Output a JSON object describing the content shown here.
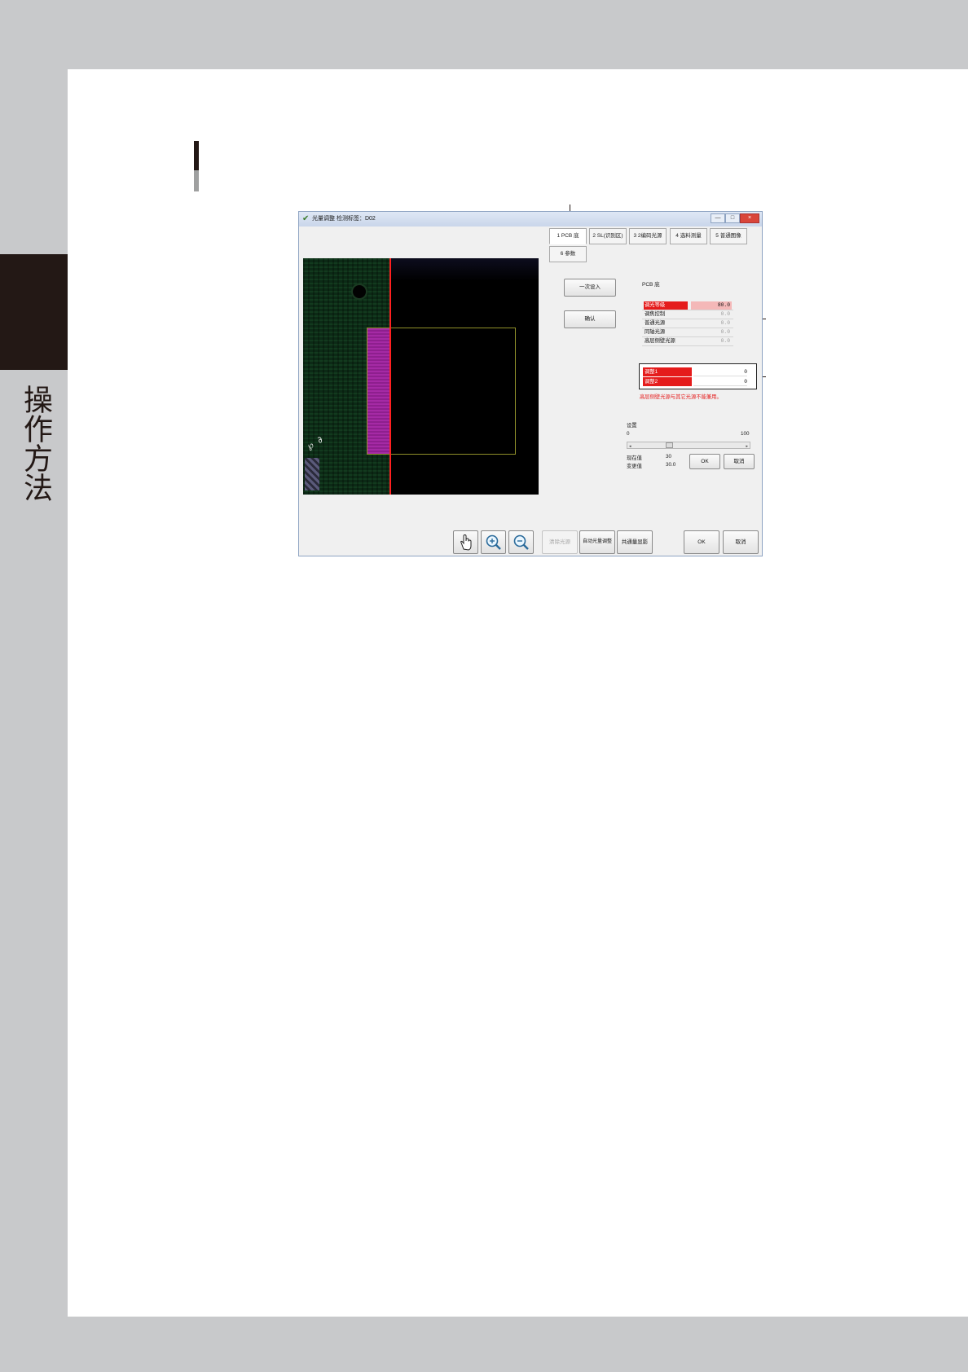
{
  "side_label": "操作方法",
  "window": {
    "title": "光量调整  检测标签：D02",
    "controls": [
      "—",
      "□",
      "×"
    ]
  },
  "tabs": [
    "1 PCB 底",
    "2 SL(识别区)",
    "3 2编码光源",
    "4 选料测量",
    "5 普通图像",
    "6 参数"
  ],
  "buttons": {
    "set_all": "一次设入",
    "confirm": "确认",
    "ok_small": "OK",
    "cancel_small": "取消",
    "clear_light": "清除光源",
    "auto_adjust": "自动光量调整",
    "single_light": "共通量显影",
    "ok": "OK",
    "cancel": "取消"
  },
  "params": {
    "group_title": "PCB 底",
    "rows": [
      {
        "label": "调光等级",
        "value": "80.0"
      },
      {
        "label": "调焦控制",
        "value": "0.0"
      },
      {
        "label": "普通光源",
        "value": "0.0"
      },
      {
        "label": "同轴光源",
        "value": "0.0"
      },
      {
        "label": "高层侧壁光源",
        "value": "0.0"
      }
    ]
  },
  "deltas": [
    {
      "label": "调整1",
      "value": "0"
    },
    {
      "label": "调整2",
      "value": "0"
    }
  ],
  "warning": "高层侧壁光源与其它光源不能兼用。",
  "slider": {
    "title": "设置",
    "min_label": "0",
    "max_label": "100",
    "current_label": "现在值",
    "current_value": "30",
    "changed_label": "变更值",
    "changed_value": "30.0",
    "position_fraction": 0.3
  },
  "icons": {
    "hand": "hand-pointer-icon",
    "zoom_in": "zoom-in-icon",
    "zoom_out": "zoom-out-icon"
  },
  "colors": {
    "selected_row": "#e51c1c",
    "roi_outline": "#8f8f2a",
    "scan_line": "#ff1f1f",
    "side_tab": "#231815"
  }
}
